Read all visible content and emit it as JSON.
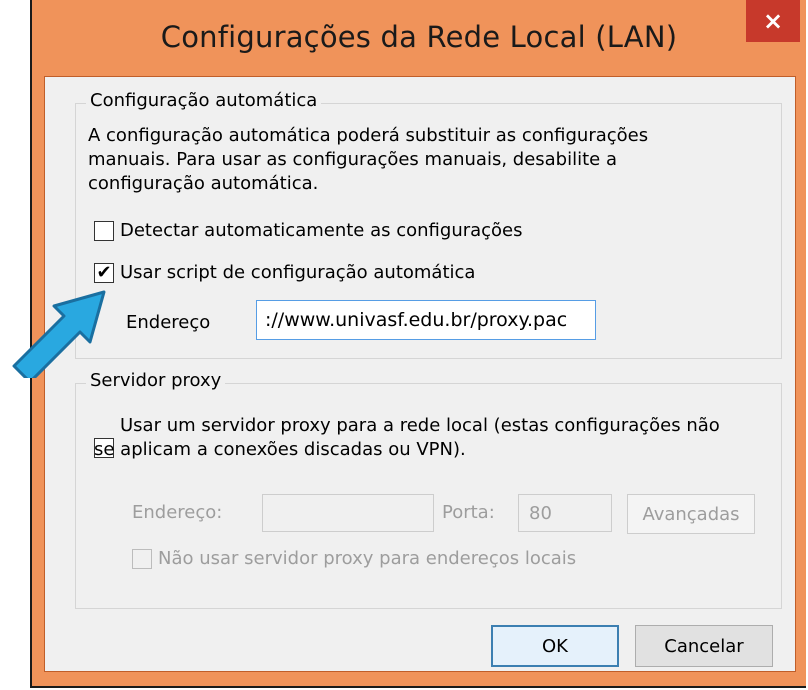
{
  "window": {
    "title": "Configurações da Rede Local (LAN)",
    "close_symbol": "×"
  },
  "auto_config": {
    "legend": "Configuração automática",
    "description": "A configuração automática poderá substituir as configurações manuais. Para usar as configurações manuais, desabilite a configuração automática.",
    "detect_label": "Detectar automaticamente as configurações",
    "detect_checked": false,
    "script_label": "Usar script de configuração automática",
    "script_checked": true,
    "check_symbol": "✔",
    "address_label": "Endereço",
    "address_value": "://www.univasf.edu.br/proxy.pac"
  },
  "proxy": {
    "legend": "Servidor proxy",
    "use_proxy_label_line1": "Usar um servidor proxy para a rede local (estas configurações não",
    "use_proxy_label_line2": "se aplicam a conexões discadas ou VPN).",
    "use_proxy_checked": false,
    "address_label": "Endereço:",
    "address_value": "",
    "port_label": "Porta:",
    "port_value": "80",
    "advanced_label": "Avançadas",
    "bypass_local_label": "Não usar servidor proxy para endereços locais",
    "bypass_local_checked": false
  },
  "buttons": {
    "ok": "OK",
    "cancel": "Cancelar"
  },
  "colors": {
    "title_bar": "#f0935a",
    "close_button": "#c7392b",
    "arrow": "#29a8e0"
  }
}
